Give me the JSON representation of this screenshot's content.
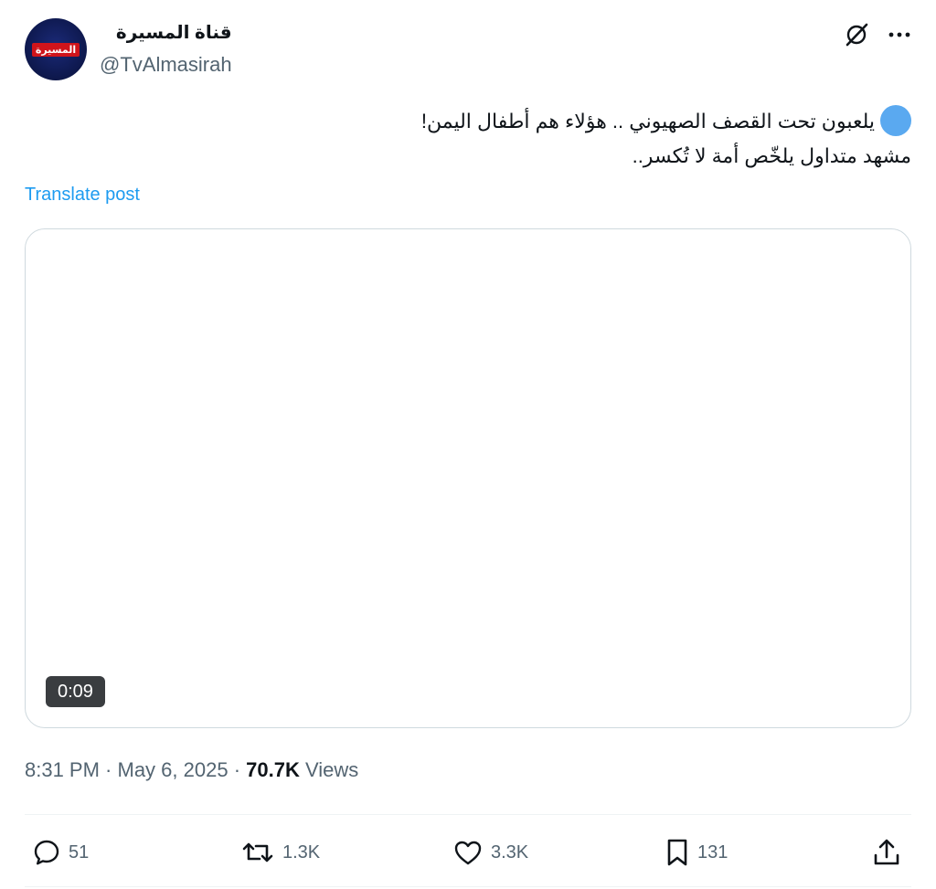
{
  "author": {
    "display_name": "قناة المسيرة",
    "handle": "@TvAlmasirah",
    "avatar_logo_text": "المسيرة"
  },
  "post": {
    "line1": "يلعبون تحت القصف الصهيوني .. هؤلاء هم أطفال اليمن!",
    "line2": "مشهد متداول يلخّص أمة لا تُكسر..",
    "translate_label": "Translate post"
  },
  "media": {
    "duration": "0:09"
  },
  "meta": {
    "time": "8:31 PM",
    "separator": " · ",
    "date": "May 6, 2025",
    "views_count": "70.7K",
    "views_label": "Views"
  },
  "actions": {
    "replies": "51",
    "reposts": "1.3K",
    "likes": "3.3K",
    "bookmarks": "131"
  },
  "icons": {
    "grok": "grok-icon",
    "more": "more-icon",
    "reply": "reply-icon",
    "repost": "repost-icon",
    "like": "heart-icon",
    "bookmark": "bookmark-icon",
    "share": "share-icon"
  },
  "colors": {
    "link": "#1d9bf0",
    "muted": "#536471",
    "text": "#0f1419",
    "border": "#cfd9de"
  }
}
